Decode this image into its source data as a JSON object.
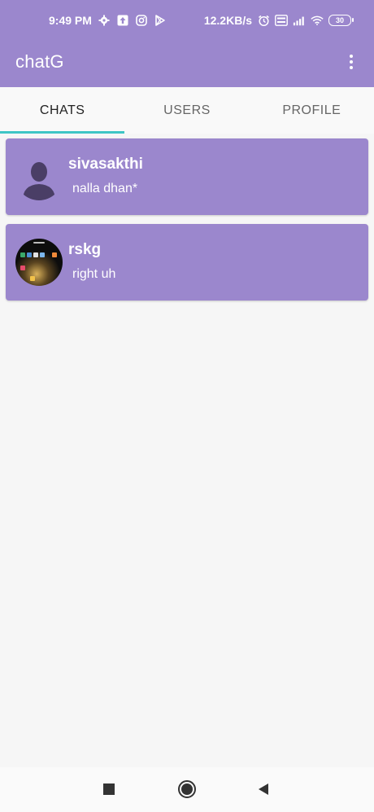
{
  "status_bar": {
    "time": "9:49 PM",
    "network_speed": "12.2KB/s",
    "battery": "30",
    "left_icons": [
      "gear-icon",
      "upload-icon",
      "instagram-icon",
      "play-store-icon"
    ],
    "right_icons": [
      "alarm-icon",
      "volte-icon",
      "signal-icon",
      "wifi-icon",
      "battery-icon"
    ]
  },
  "app_bar": {
    "title": "chatG",
    "menu_icon": "more-vert-icon"
  },
  "tabs": [
    {
      "label": "CHATS",
      "active": true
    },
    {
      "label": "USERS",
      "active": false
    },
    {
      "label": "PROFILE",
      "active": false
    }
  ],
  "chats": [
    {
      "name": "sivasakthi",
      "last_message": "nalla dhan*",
      "avatar": "default-person-icon"
    },
    {
      "name": "rskg",
      "last_message": "right uh",
      "avatar": "photo-avatar"
    }
  ],
  "colors": {
    "primary": "#9b87cd",
    "accent": "#3ec5c5",
    "background": "#f6f6f6"
  },
  "nav_bar": {
    "icons": [
      "recents-square-icon",
      "home-circle-icon",
      "back-triangle-icon"
    ]
  }
}
